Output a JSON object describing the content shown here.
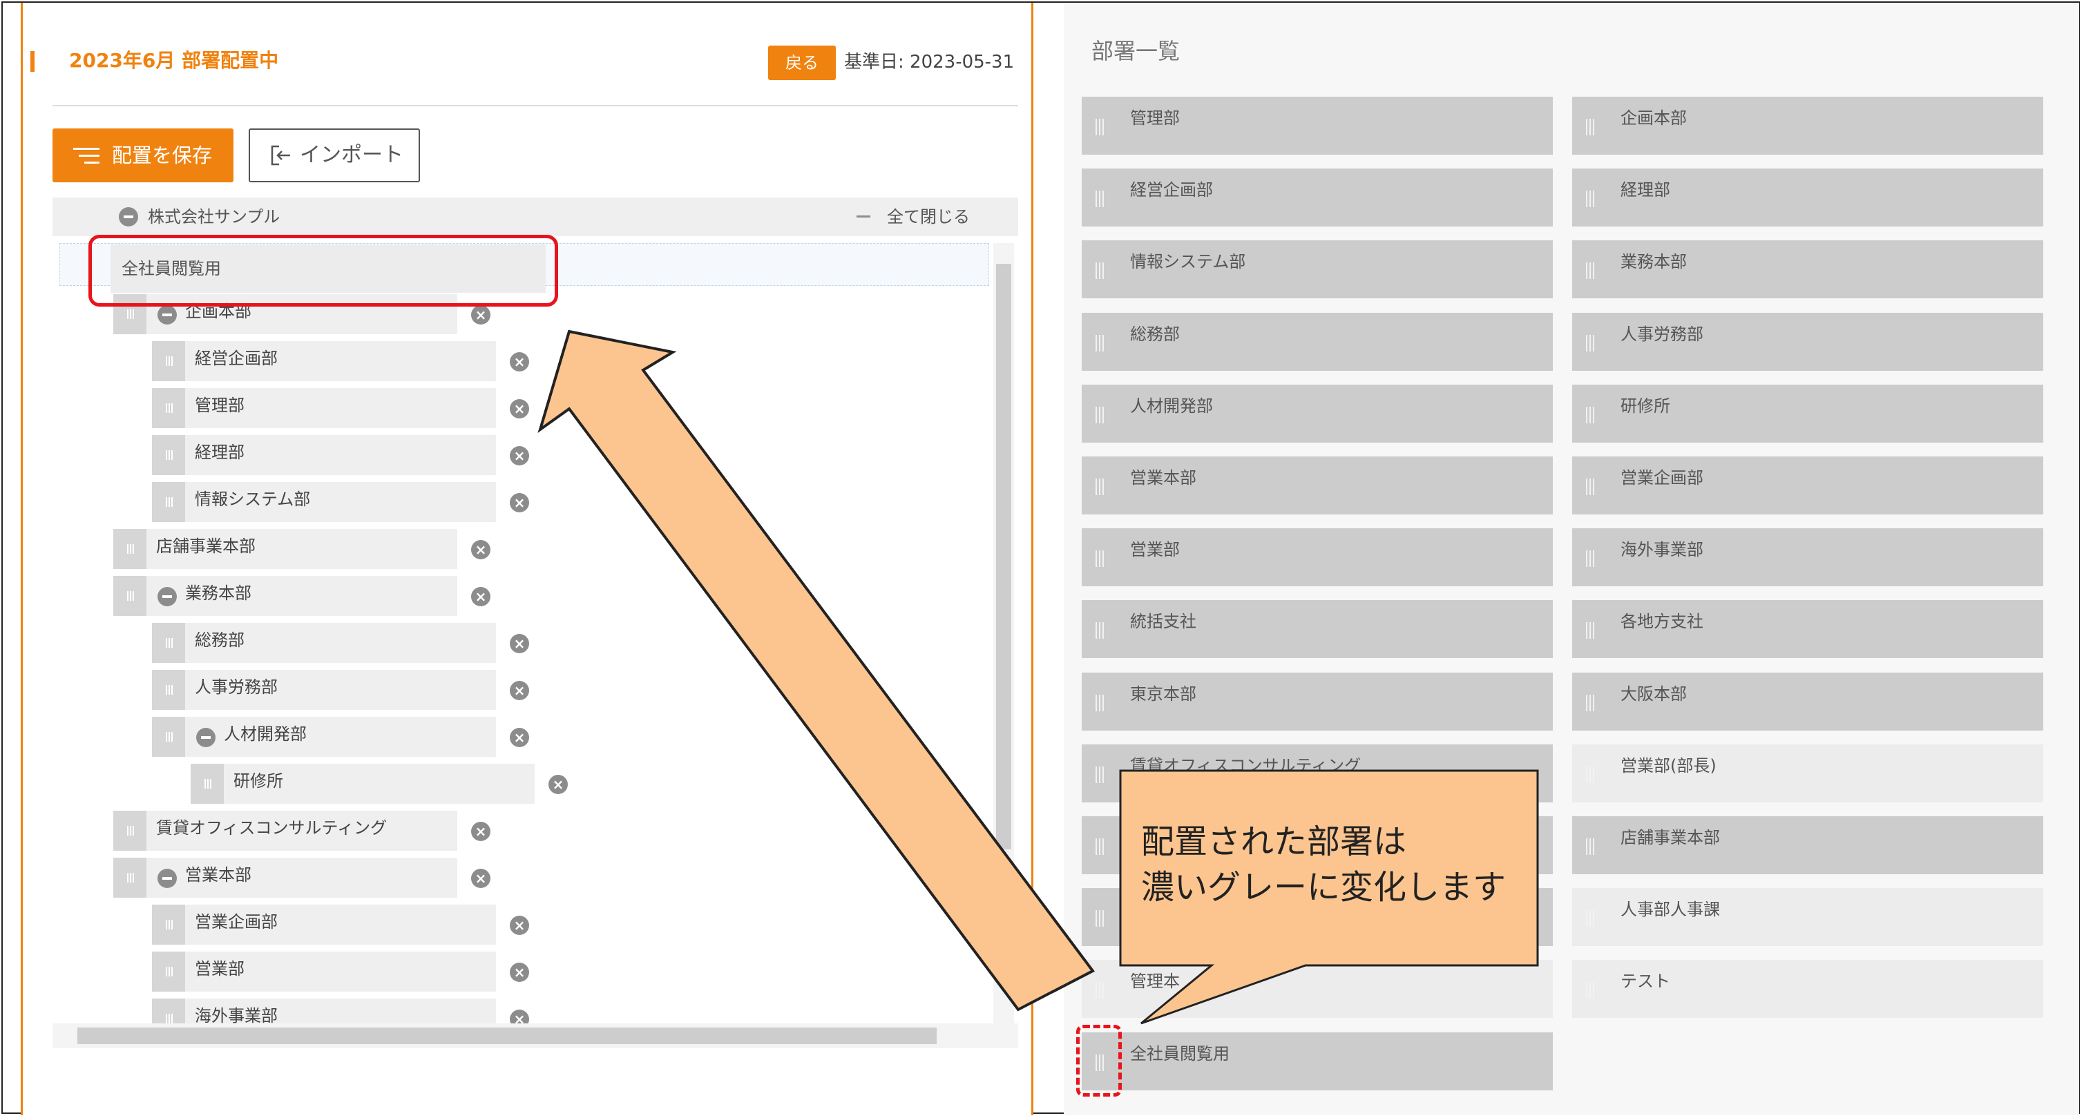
{
  "left": {
    "title": "2023年6月 部署配置中",
    "back_label": "戻る",
    "base_date": "基準日: 2023-05-31",
    "save_label": "配置を保存",
    "import_label": "インポート",
    "company": "株式会社サンプル",
    "collapse_all": "全て閉じる",
    "dragging_item": "全社員閲覧用",
    "tree": [
      {
        "label": "企画本部",
        "expanded": true
      },
      {
        "label": "経営企画部"
      },
      {
        "label": "管理部"
      },
      {
        "label": "経理部"
      },
      {
        "label": "情報システム部"
      },
      {
        "label": "店舗事業本部"
      },
      {
        "label": "業務本部",
        "expanded": true
      },
      {
        "label": "総務部"
      },
      {
        "label": "人事労務部"
      },
      {
        "label": "人材開発部",
        "expanded": true
      },
      {
        "label": "研修所"
      },
      {
        "label": "賃貸オフィスコンサルティング"
      },
      {
        "label": "営業本部",
        "expanded": true
      },
      {
        "label": "営業企画部"
      },
      {
        "label": "営業部"
      },
      {
        "label": "海外事業部"
      }
    ]
  },
  "right": {
    "title": "部署一覧",
    "tiles": [
      {
        "label": "管理部",
        "placed": true
      },
      {
        "label": "企画本部",
        "placed": true
      },
      {
        "label": "経営企画部",
        "placed": true
      },
      {
        "label": "経理部",
        "placed": true
      },
      {
        "label": "情報システム部",
        "placed": true
      },
      {
        "label": "業務本部",
        "placed": true
      },
      {
        "label": "総務部",
        "placed": true
      },
      {
        "label": "人事労務部",
        "placed": true
      },
      {
        "label": "人材開発部",
        "placed": true
      },
      {
        "label": "研修所",
        "placed": true
      },
      {
        "label": "営業本部",
        "placed": true
      },
      {
        "label": "営業企画部",
        "placed": true
      },
      {
        "label": "営業部",
        "placed": true
      },
      {
        "label": "海外事業部",
        "placed": true
      },
      {
        "label": "統括支社",
        "placed": true
      },
      {
        "label": "各地方支社",
        "placed": true
      },
      {
        "label": "東京本部",
        "placed": true
      },
      {
        "label": "大阪本部",
        "placed": true
      },
      {
        "label": "賃貸オフィスコンサルティング",
        "placed": true
      },
      {
        "label": "営業部(部長)",
        "placed": false
      },
      {
        "label": "",
        "placed": true
      },
      {
        "label": "店舗事業本部",
        "placed": true
      },
      {
        "label": "",
        "placed": true
      },
      {
        "label": "人事部人事課",
        "placed": false
      },
      {
        "label": "管理本",
        "placed": false
      },
      {
        "label": "テスト",
        "placed": false
      },
      {
        "label": "全社員閲覧用",
        "placed": true
      }
    ]
  },
  "callout": {
    "line1": "配置された部署は",
    "line2": "濃いグレーに変化します"
  },
  "colors": {
    "accent": "#f0820f",
    "highlight": "#e8141c",
    "arrow_fill": "#fcc58f",
    "callout_fill": "#fcc58f",
    "placed_tile": "#cccccc",
    "unplaced_tile": "#ececec"
  }
}
